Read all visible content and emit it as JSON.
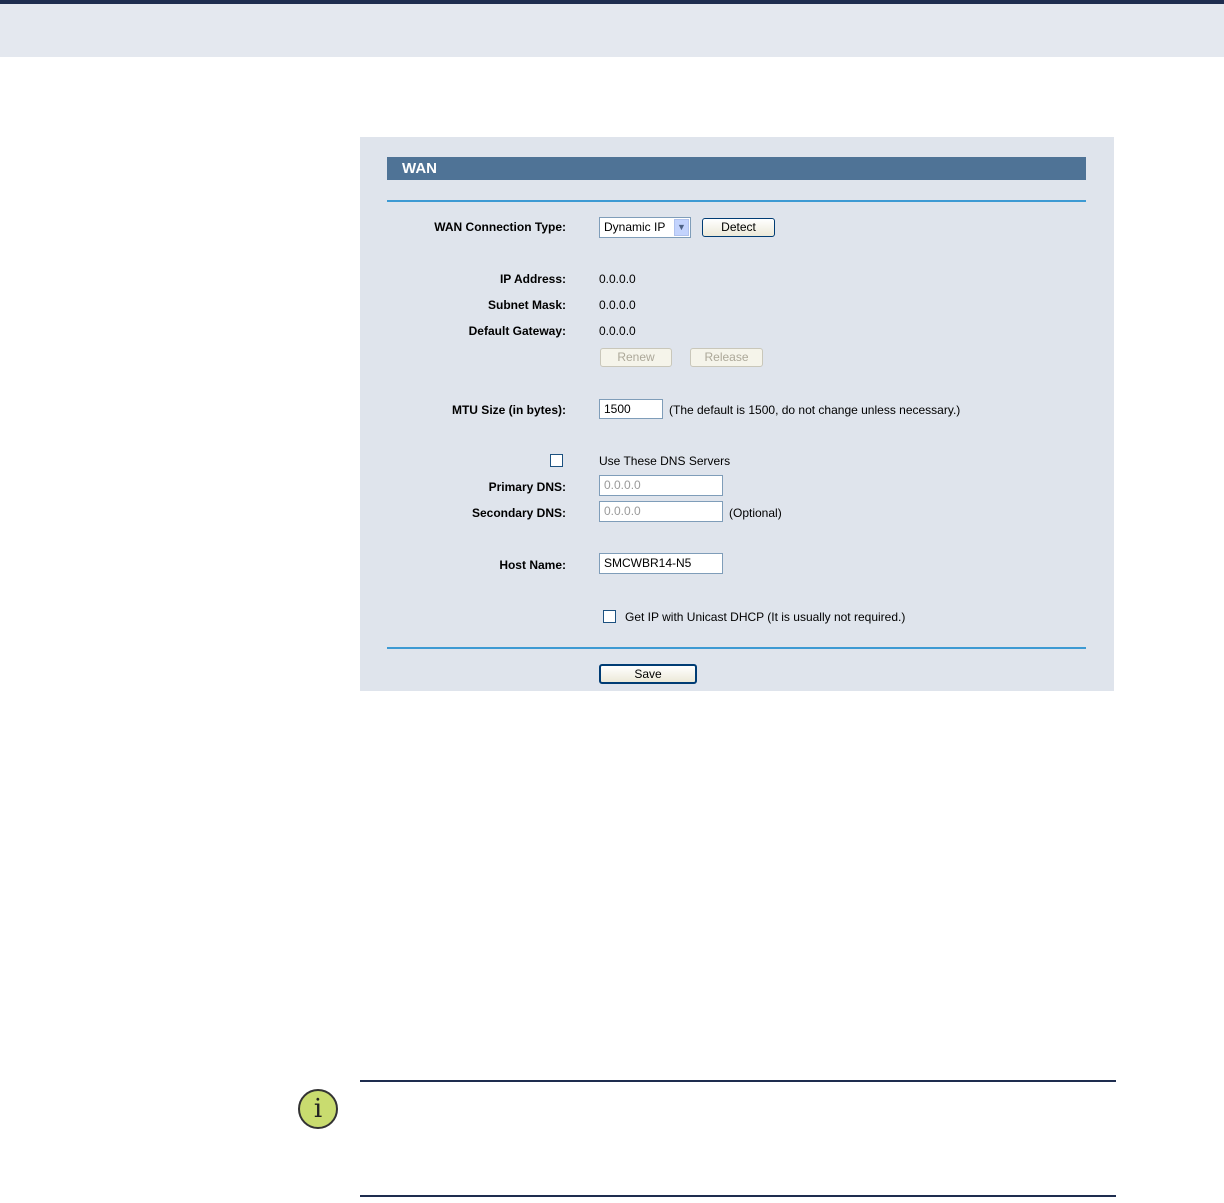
{
  "panel": {
    "title": "WAN"
  },
  "wan_type": {
    "label": "WAN Connection Type:",
    "selected": "Dynamic IP",
    "detect": "Detect"
  },
  "ip": {
    "label": "IP Address:",
    "value": "0.0.0.0"
  },
  "mask": {
    "label": "Subnet Mask:",
    "value": "0.0.0.0"
  },
  "gateway": {
    "label": "Default Gateway:",
    "value": "0.0.0.0"
  },
  "buttons": {
    "renew": "Renew",
    "release": "Release",
    "save": "Save"
  },
  "mtu": {
    "label": "MTU Size (in bytes):",
    "value": "1500",
    "hint": "(The default is 1500, do not change unless necessary.)"
  },
  "dns": {
    "use_label": "Use These DNS Servers",
    "use_checked": false,
    "primary_label": "Primary DNS:",
    "primary_value": "0.0.0.0",
    "secondary_label": "Secondary DNS:",
    "secondary_value": "0.0.0.0",
    "optional": "(Optional)"
  },
  "host": {
    "label": "Host Name:",
    "value": "SMCWBR14-N5"
  },
  "unicast": {
    "label": "Get IP with Unicast DHCP (It is usually not required.)",
    "checked": false
  },
  "icons": {
    "note": "info-icon",
    "dropdown": "chevron-down-icon"
  },
  "colors": {
    "title_bar": "#4f7396",
    "rule": "#3d9ad3",
    "panel_bg": "#dfe4ec"
  }
}
